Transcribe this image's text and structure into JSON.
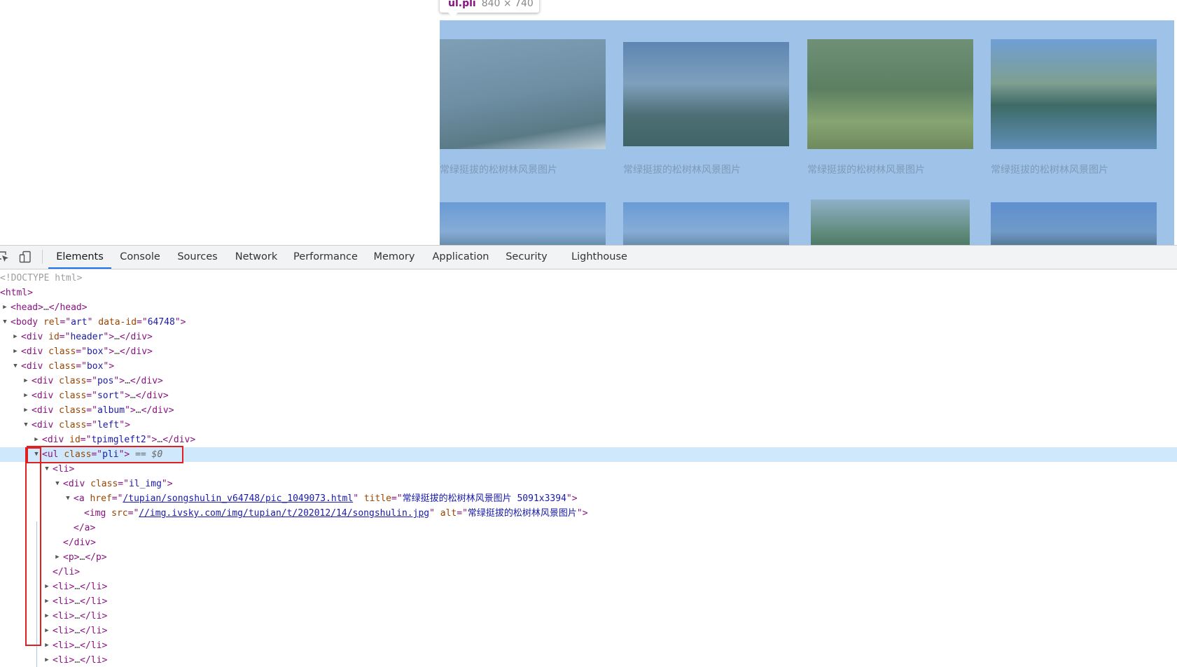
{
  "page": {
    "tooltip": {
      "selector": "ul.pli",
      "size": "840 × 740"
    },
    "caption": "常绿挺拔的松树林风景图片"
  },
  "devtools": {
    "tabs": [
      "Elements",
      "Console",
      "Sources",
      "Network",
      "Performance",
      "Memory",
      "Application",
      "Security",
      "Lighthouse"
    ],
    "active_tab": "Elements",
    "icons": [
      "inspect-element-icon",
      "device-toolbar-icon"
    ],
    "dom": {
      "doctype": "<!DOCTYPE html>",
      "html_tag": "<html>",
      "head_open": "<head>",
      "head_close": "</head>",
      "body": {
        "tag": "body",
        "rel": "art",
        "data_id": "64748"
      },
      "header_div": {
        "attr": "id",
        "value": "header"
      },
      "box_div": {
        "attr": "class",
        "value": "box"
      },
      "box_div_open": {
        "attr": "class",
        "value": "box"
      },
      "pos_div": {
        "attr": "class",
        "value": "pos"
      },
      "sort_div": {
        "attr": "class",
        "value": "sort"
      },
      "album_div": {
        "attr": "class",
        "value": "album"
      },
      "left_div": {
        "attr": "class",
        "value": "left"
      },
      "tpimg_div": {
        "attr": "id",
        "value": "tpimgleft2"
      },
      "ul_pli": {
        "attr": "class",
        "value": "pli",
        "marker": "== $0"
      },
      "li_open": "<li>",
      "il_img_div": {
        "attr": "class",
        "value": "il_img"
      },
      "anchor": {
        "href": "/tupian/songshulin_v64748/pic_1049073.html",
        "title": "常绿挺拔的松树林风景图片 5091x3394"
      },
      "img": {
        "src": "//img.ivsky.com/img/tupian/t/202012/14/songshulin.jpg",
        "alt": "常绿挺拔的松树林风景图片"
      },
      "a_close": "</a>",
      "div_close": "</div>",
      "p_open": "<p>",
      "p_close": "</p>",
      "li_close": "</li>",
      "li_collapsed": {
        "open": "<li>",
        "ellipsis": "…",
        "close": "</li>"
      }
    }
  }
}
